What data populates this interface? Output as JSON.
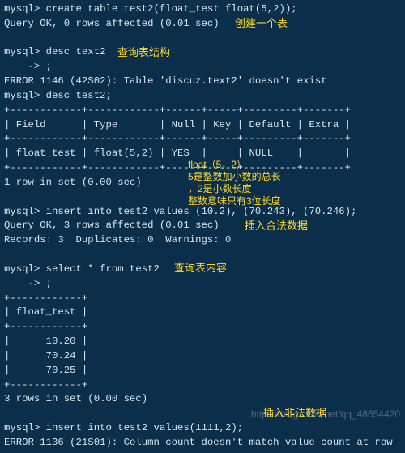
{
  "terminal": {
    "l00": "mysql> create table test2(float_test float(5,2));",
    "l01": "Query OK, 0 rows affected (0.01 sec)",
    "l02": "",
    "l03": "mysql> desc text2",
    "l04": "    -> ;",
    "l05": "ERROR 1146 (42S02): Table 'discuz.text2' doesn't exist",
    "l06": "mysql> desc test2;",
    "l07": "+------------+------------+------+-----+---------+-------+",
    "l08": "| Field      | Type       | Null | Key | Default | Extra |",
    "l09": "+------------+------------+------+-----+---------+-------+",
    "l10": "| float_test | float(5,2) | YES  |     | NULL    |       |",
    "l11": "+------------+------------+------+-----+---------+-------+",
    "l12": "1 row in set (0.00 sec)",
    "l13": "",
    "l14": "mysql> insert into test2 values (10.2), (70.243), (70.246);",
    "l15": "Query OK, 3 rows affected (0.01 sec)",
    "l16": "Records: 3  Duplicates: 0  Warnings: 0",
    "l17": "",
    "l18": "mysql> select * from test2",
    "l19": "    -> ;",
    "l20": "+------------+",
    "l21": "| float_test |",
    "l22": "+------------+",
    "l23": "|      10.20 |",
    "l24": "|      70.24 |",
    "l25": "|      70.25 |",
    "l26": "+------------+",
    "l27": "3 rows in set (0.00 sec)",
    "l28": "",
    "l29": "mysql> insert into test2 values(1111,2);",
    "l30": "ERROR 1136 (21S01): Column count doesn't match value count at row"
  },
  "annotations": {
    "a1": "创建一个表",
    "a2": "查询表结构",
    "a3_1": "float（5，2）",
    "a3_2": "5是整数加小数的总长",
    "a3_3": "，2是小数长度",
    "a3_4": "整数意味只有3位长度",
    "a4": "插入合法数据",
    "a5": "查询表内容",
    "a6": "插入非法数据"
  },
  "watermark": "https://blog.csdn.net/qq_48654420"
}
